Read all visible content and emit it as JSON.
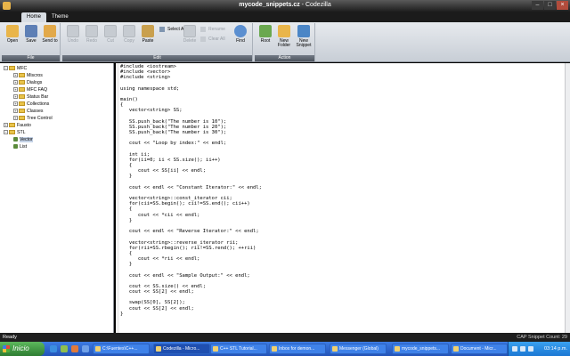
{
  "window": {
    "title_file": "mycode_snippets.cz",
    "title_sep": " - ",
    "title_app": "Codezilla"
  },
  "window_controls": {
    "minimize": "–",
    "maximize": "□",
    "close": "×"
  },
  "tabs": [
    {
      "label": "Home"
    },
    {
      "label": "Theme"
    }
  ],
  "ribbon": {
    "file": {
      "label": "File",
      "open": "Open",
      "save": "Save",
      "send_to": "Send to"
    },
    "edit": {
      "label": "Edit",
      "undo": "Undo",
      "redo": "Redo",
      "cut": "Cut",
      "copy": "Copy",
      "paste": "Paste",
      "select_all": "Select All",
      "delete": "Delete",
      "rename": "Rename",
      "clear_all": "Clear All",
      "find": "Find"
    },
    "action": {
      "label": "Action",
      "root": "Root",
      "new_folder": "New Folder",
      "new_snippet": "New Snippet"
    }
  },
  "tree": [
    {
      "label": "MFC",
      "exp": "−",
      "indent": 0,
      "type": "folder"
    },
    {
      "label": "Miscros",
      "exp": "+",
      "indent": 1,
      "type": "folder"
    },
    {
      "label": "Dialogs",
      "exp": "+",
      "indent": 1,
      "type": "folder"
    },
    {
      "label": "MFC FAQ",
      "exp": "+",
      "indent": 1,
      "type": "folder"
    },
    {
      "label": "Status Bar",
      "exp": "+",
      "indent": 1,
      "type": "folder"
    },
    {
      "label": "Collections",
      "exp": "+",
      "indent": 1,
      "type": "folder"
    },
    {
      "label": "Classes",
      "exp": "+",
      "indent": 1,
      "type": "folder"
    },
    {
      "label": "Tree Control",
      "exp": "+",
      "indent": 1,
      "type": "folder"
    },
    {
      "label": "Fausto",
      "exp": "+",
      "indent": 0,
      "type": "folder"
    },
    {
      "label": "STL",
      "exp": "−",
      "indent": 0,
      "type": "folder"
    },
    {
      "label": "Vector",
      "exp": "",
      "indent": 1,
      "type": "leaf",
      "selected": true
    },
    {
      "label": "List",
      "exp": "",
      "indent": 1,
      "type": "leaf"
    }
  ],
  "code": [
    "#include <iostream>",
    "#include <vector>",
    "#include <string>",
    "",
    "using namespace std;",
    "",
    "main()",
    "{",
    "   vector<string> SS;",
    "",
    "   SS.push_back(\"The number is 10\");",
    "   SS.push_back(\"The number is 20\");",
    "   SS.push_back(\"The number is 30\");",
    "",
    "   cout << \"Loop by index:\" << endl;",
    "",
    "   int ii;",
    "   for(ii=0; ii < SS.size(); ii++)",
    "   {",
    "      cout << SS[ii] << endl;",
    "   }",
    "",
    "   cout << endl << \"Constant Iterator:\" << endl;",
    "",
    "   vector<string>::const_iterator cii;",
    "   for(cii=SS.begin(); cii!=SS.end(); cii++)",
    "   {",
    "      cout << *cii << endl;",
    "   }",
    "",
    "   cout << endl << \"Reverse Iterator:\" << endl;",
    "",
    "   vector<string>::reverse_iterator rii;",
    "   for(rii=SS.rbegin(); rii!=SS.rend(); ++rii)",
    "   {",
    "      cout << *rii << endl;",
    "   }",
    "",
    "   cout << endl << \"Sample Output:\" << endl;",
    "",
    "   cout << SS.size() << endl;",
    "   cout << SS[2] << endl;",
    "",
    "   swap(SS[0], SS[2]);",
    "   cout << SS[2] << endl;",
    "}"
  ],
  "status": {
    "left": "Ready",
    "right": "CAP  Snippet Count: 29"
  },
  "taskbar": {
    "start": "Inicio",
    "tasks": [
      {
        "label": "C:\\Fuentes\\C++..."
      },
      {
        "label": "Codezilla - Micro..."
      },
      {
        "label": "C++ STL Tutorial..."
      },
      {
        "label": "Inbox for demon..."
      },
      {
        "label": "Messenger (Global)"
      },
      {
        "label": "mycode_snippets..."
      },
      {
        "label": "Document - Micr..."
      }
    ],
    "clock": "03:14 p.m."
  },
  "colors": {
    "accent": "#3c7be3",
    "ribbon": "#dde2e8",
    "chrome": "#1e1e1e"
  }
}
